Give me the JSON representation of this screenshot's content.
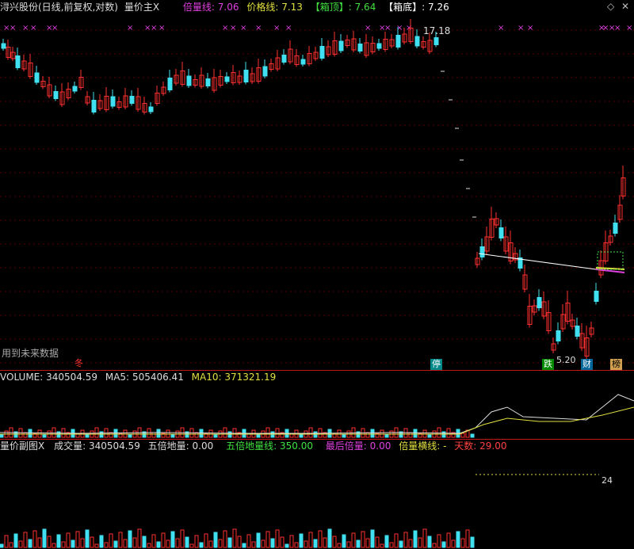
{
  "header": {
    "title": "浔兴股份(日线,前复权,对数)",
    "indicator": "量价主X",
    "items": [
      {
        "label": "倍量线",
        "value": "7.06",
        "color": "#e040e0"
      },
      {
        "label": "价格线",
        "value": "7.13",
        "color": "#e0e040"
      },
      {
        "label": "【箱顶】",
        "value": "7.64",
        "color": "#40e040"
      },
      {
        "label": "【箱底】",
        "value": "7.26",
        "color": "#ffffff"
      }
    ],
    "window_controls": [
      "◇",
      "✕"
    ]
  },
  "main": {
    "high_label": "17.18",
    "low_label": "5.20",
    "warning": "用到未来数据",
    "badges": [
      {
        "text": "停",
        "color": "#ffffff",
        "bg": "#008888"
      },
      {
        "text": "跌",
        "color": "#ffffff",
        "bg": "#008800"
      },
      {
        "text": "财",
        "color": "#ffffff",
        "bg": "#006699"
      },
      {
        "text": "榜",
        "color": "#000000",
        "bg": "#d0a050"
      }
    ],
    "pre_marker": "冬",
    "x_marks": "×"
  },
  "volume": {
    "items": [
      {
        "label": "VOLUME:",
        "value": "340504.59",
        "color": "#dddddd"
      },
      {
        "label": "MA5:",
        "value": "505406.41",
        "color": "#dddddd"
      },
      {
        "label": "MA10:",
        "value": "371321.19",
        "color": "#e0e040"
      }
    ]
  },
  "sub": {
    "title": "量价副图X",
    "items": [
      {
        "label": "成交量:",
        "value": "340504.59",
        "color": "#dddddd"
      },
      {
        "label": "五倍地量:",
        "value": "0.00",
        "color": "#dddddd"
      },
      {
        "label": "五倍地量线:",
        "value": "350.00",
        "color": "#40e040"
      },
      {
        "label": "最后倍量:",
        "value": "0.00",
        "color": "#e040e0"
      },
      {
        "label": "倍量横线:",
        "value": "-",
        "color": "#e0e040"
      },
      {
        "label": "天数:",
        "value": "29.00",
        "color": "#ff4040"
      }
    ],
    "days_label": "24"
  },
  "colors": {
    "up": "#ff3030",
    "down": "#40e0f0",
    "bg": "#000000",
    "grid": "#800000"
  }
}
